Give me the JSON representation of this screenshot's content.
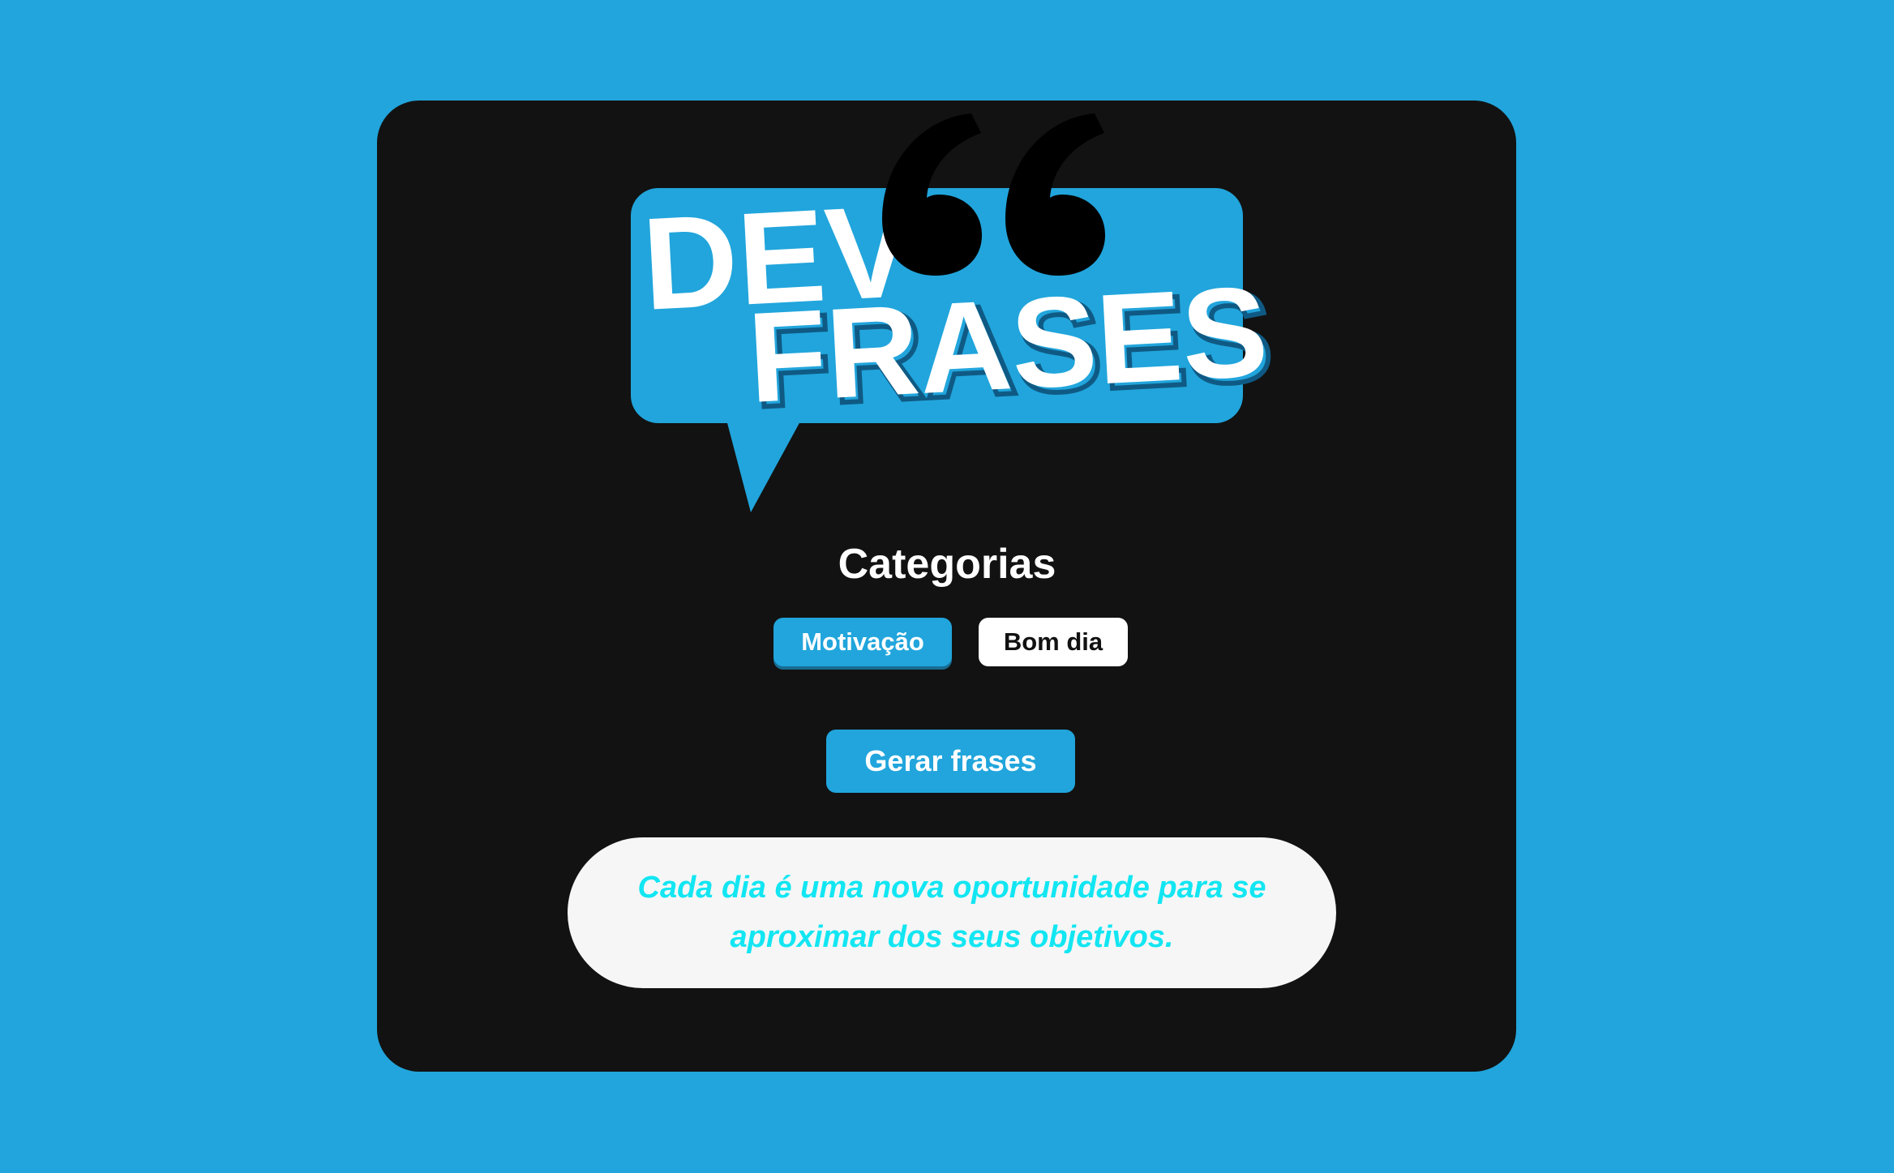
{
  "logo": {
    "line1": "DEV",
    "line2": "FRASES",
    "colors": {
      "bubble": "#21a5dc",
      "text": "#ffffff",
      "quote_marks": "#000000"
    }
  },
  "categories": {
    "heading": "Categorias",
    "items": [
      {
        "label": "Motivação",
        "active": true
      },
      {
        "label": "Bom dia",
        "active": false
      }
    ]
  },
  "actions": {
    "generate_label": "Gerar frases"
  },
  "quote": {
    "text": "Cada dia é uma nova oportunidade para se aproximar dos seus objetivos."
  },
  "colors": {
    "page_background": "#21a5dc",
    "card_background": "#121212",
    "accent": "#21a5dc",
    "quote_text": "#12e6f2",
    "quote_background": "#f6f6f6"
  }
}
